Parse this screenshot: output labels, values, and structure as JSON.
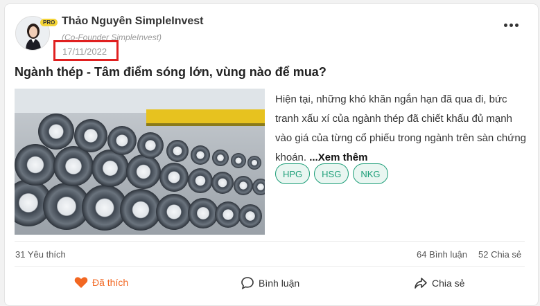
{
  "author": {
    "name": "Thảo Nguyên SimpleInvest",
    "role": "(Co-Founder SimpleInvest)",
    "badge": "PRO",
    "date": "17/11/2022"
  },
  "post": {
    "title": "Ngành thép - Tâm điểm sóng lớn, vùng nào để mua?",
    "excerpt": "Hiện tại, những khó khăn ngắn hạn đã qua đi, bức tranh xấu xí của ngành thép đã chiết khấu đủ mạnh vào giá của từng cổ phiếu trong ngành trên sàn chứng khoán.",
    "read_more": "...Xem thêm",
    "tags": [
      "HPG",
      "HSG",
      "NKG"
    ],
    "image_alt": "steel-wire-coils"
  },
  "stats": {
    "likes": "31 Yêu thích",
    "comments": "64 Bình luận",
    "shares": "52 Chia sẻ"
  },
  "actions": {
    "like_label": "Đã thích",
    "comment_label": "Bình luận",
    "share_label": "Chia sẻ"
  },
  "colors": {
    "accent": "#f26722",
    "tag": "#1c9e78",
    "highlight_box": "#e02020"
  }
}
